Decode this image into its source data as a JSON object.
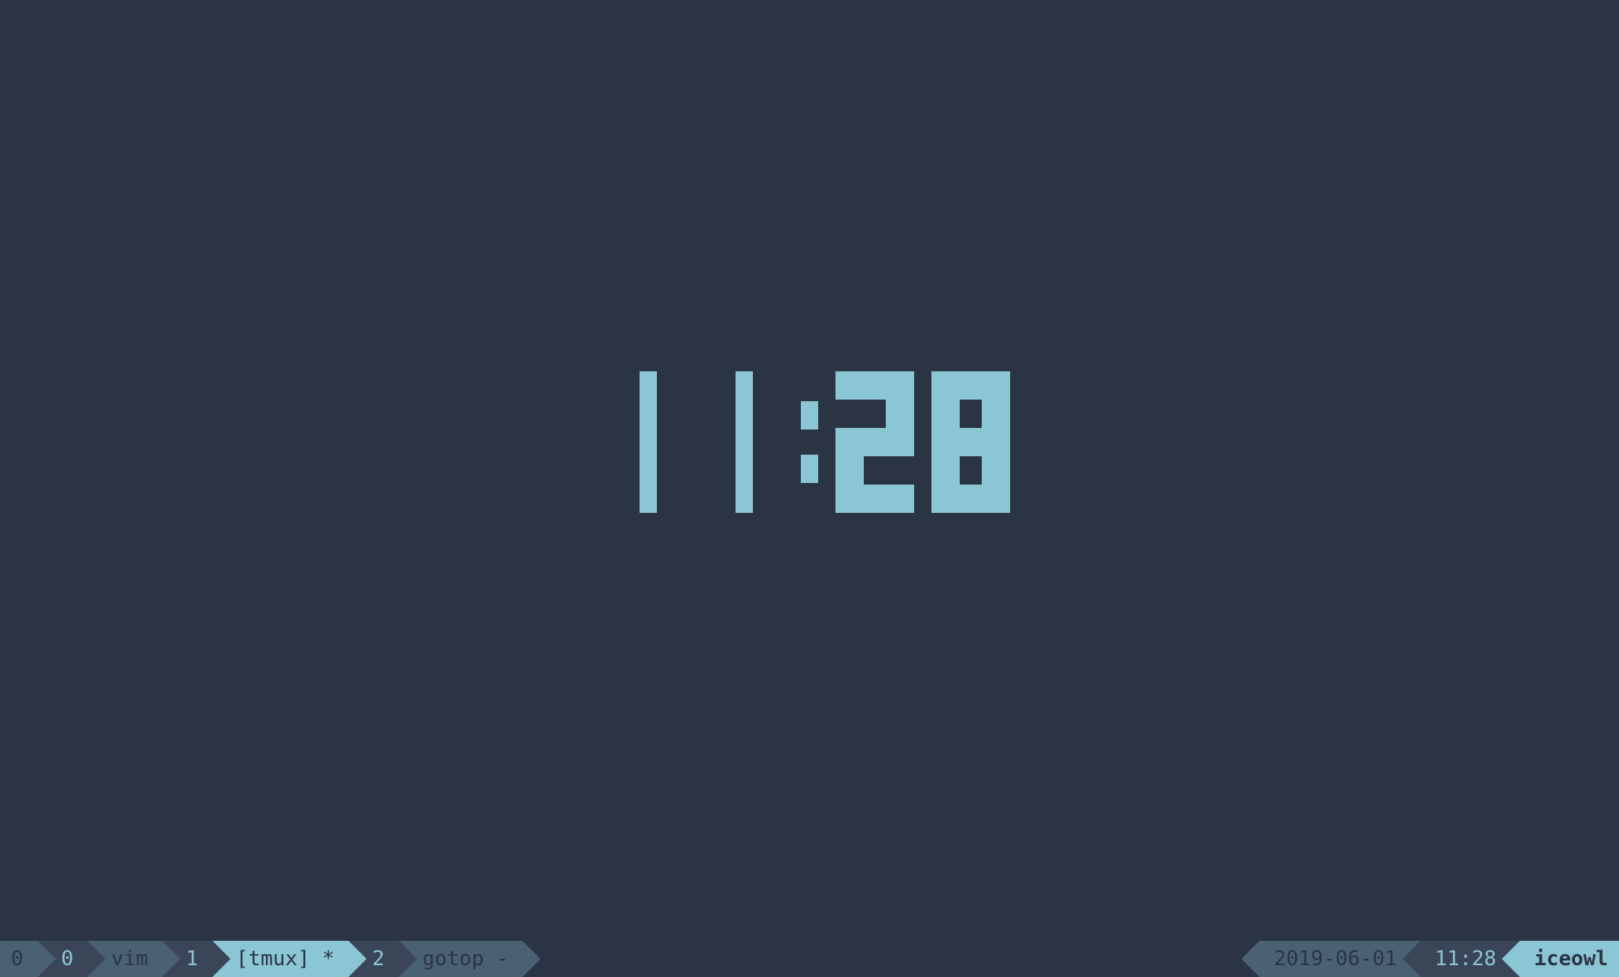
{
  "clock": {
    "time": "11:28",
    "digits": [
      "1",
      "1",
      ":",
      "2",
      "8"
    ]
  },
  "status": {
    "session_index": "0",
    "windows": [
      {
        "index": "0",
        "name": "vim",
        "active": false,
        "flag": ""
      },
      {
        "index": "1",
        "name": "[tmux]",
        "active": true,
        "flag": "*"
      },
      {
        "index": "2",
        "name": "gotop",
        "active": false,
        "flag": "-"
      }
    ],
    "date": "2019-06-01",
    "time": "11:28",
    "hostname": "iceowl"
  }
}
